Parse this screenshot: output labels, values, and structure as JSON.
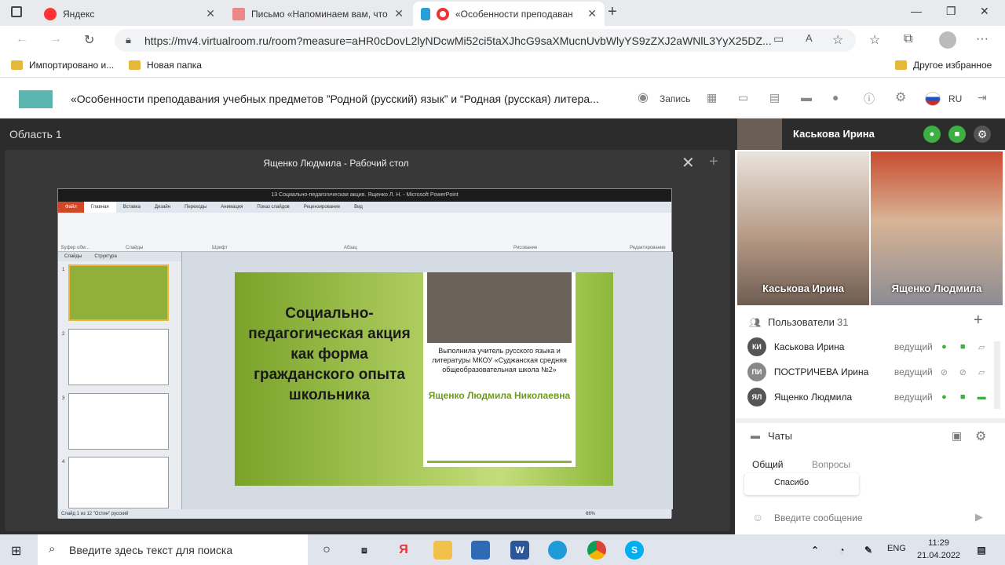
{
  "browser": {
    "tabs": [
      {
        "label": "Яндекс"
      },
      {
        "label": "Письмо «Напоминаем вам, что"
      },
      {
        "label": "«Особенности преподаван"
      }
    ],
    "url": "https://mv4.virtualroom.ru/room?measure=aHR0cDovL2lyNDcwMi52ci5taXJhcG9saXMucnUvbWlyYS9zZXJ2aWNlL3YyX25DZ...",
    "bookmarks": [
      "Импортировано и...",
      "Новая папка"
    ],
    "other_bookmarks": "Другое избранное"
  },
  "app": {
    "title": "«Особенности преподавания учебных предметов ”Родной (русский) язык” и “Родная (русская) литера...",
    "record_label": "Запись",
    "lang": "RU",
    "area_label": "Область 1",
    "share_title": "Ященко Людмила - Рабочий стол"
  },
  "ppt": {
    "window_title": "13 Социально-педагогическая акция. Ященко Л. Н. - Microsoft PowerPoint",
    "ribbon_tabs": [
      "Файл",
      "Главная",
      "Вставка",
      "Дизайн",
      "Переходы",
      "Анимация",
      "Показ слайдов",
      "Рецензирование",
      "Вид"
    ],
    "groups": [
      "Буфер обм...",
      "Слайды",
      "Шрифт",
      "Абзац",
      "Рисование",
      "Редактирование"
    ],
    "pane_tabs": [
      "Слайды",
      "Структура"
    ],
    "status": "Слайд 1 из 12   \"Остин\"   русский",
    "zoom": "66%",
    "slide": {
      "title": "Социально-педагогическая акция как форма гражданского опыта школьника",
      "author": "Выполнила учитель  русского языка и литературы МКОУ «Суджанская средняя общеобразовательная школа №2»",
      "name": "Ященко Людмила Николаевна"
    }
  },
  "panel": {
    "self_name": "Каськова Ирина",
    "videos": [
      {
        "name": "Каськова Ирина",
        "bg": "#a38a7a"
      },
      {
        "name": "Ященко Людмила",
        "bg": "#c9a886"
      }
    ],
    "users_label": "Пользователи",
    "users_count": "31",
    "users": [
      {
        "initials": "КИ",
        "name": "Каськова Ирина",
        "role": "ведущий"
      },
      {
        "initials": "ПИ",
        "name": "ПОСТРИЧЕВА Ирина",
        "role": "ведущий"
      },
      {
        "initials": "ЯЛ",
        "name": "Ященко Людмила",
        "role": "ведущий"
      }
    ],
    "chats_label": "Чаты",
    "chat_tabs": [
      "Общий",
      "Вопросы"
    ],
    "chat_message": "Спасибо",
    "chat_placeholder": "Введите сообщение"
  },
  "taskbar": {
    "search_placeholder": "Введите здесь текст для поиска",
    "lang": "ENG",
    "time": "11:29",
    "date": "21.04.2022"
  }
}
